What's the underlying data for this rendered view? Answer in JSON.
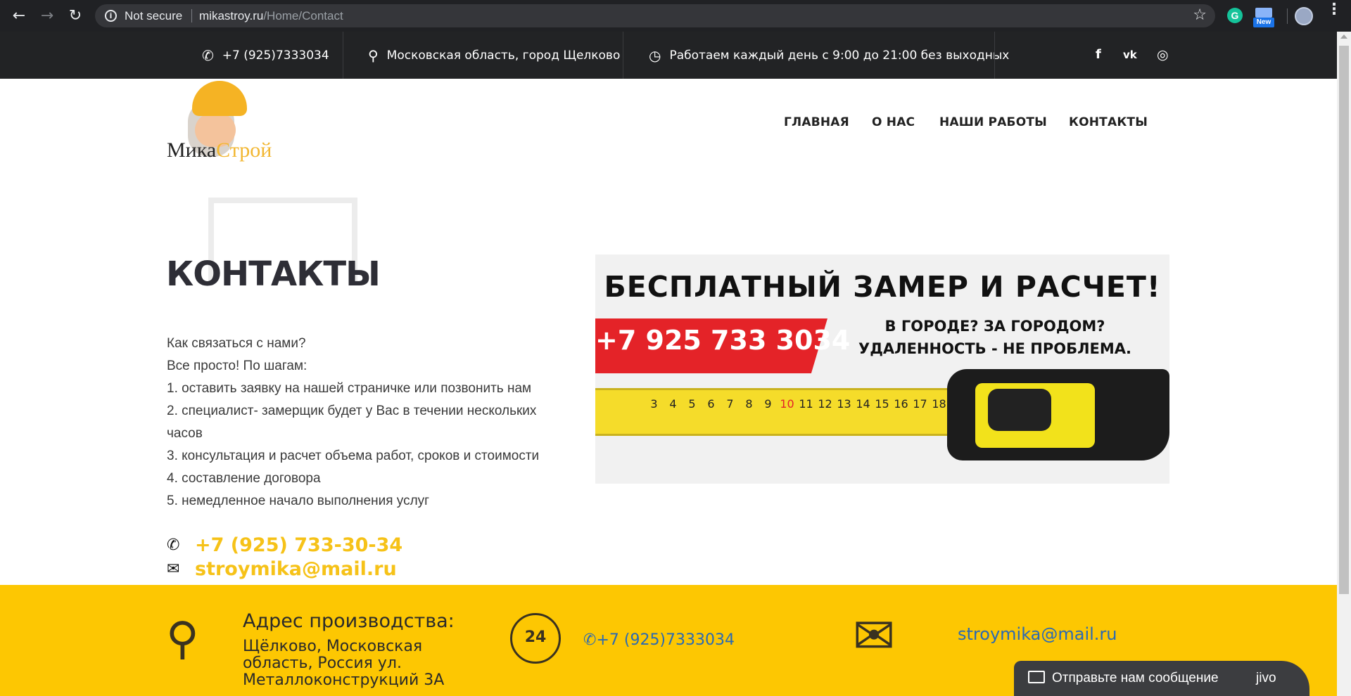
{
  "browser": {
    "security": "Not secure",
    "url_domain": "mikastroy.ru",
    "url_path": "/Home/Contact",
    "ext_new_badge": "New",
    "ext_grammarly_letter": "G"
  },
  "topbar": {
    "phone": "+7 (925)7333034",
    "address": "Московская область, город Щелково",
    "hours": "Работаем каждый день с 9:00 до 21:00 без выходных",
    "social": {
      "facebook": "f",
      "vk": "vk",
      "instagram": "◎"
    }
  },
  "logo": {
    "part1": "Мика",
    "part2": "Строй"
  },
  "nav": {
    "items": [
      {
        "label": "ГЛАВНАЯ"
      },
      {
        "label": "О НАС"
      },
      {
        "label": "НАШИ РАБОТЫ"
      },
      {
        "label": "КОНТАКТЫ"
      }
    ]
  },
  "main": {
    "title": "КОНТАКТЫ",
    "lines": [
      "Как связаться с нами?",
      "Все просто! По шагам:",
      "1. оставить заявку на нашей страничке или позвонить нам",
      "2. специалист- замерщик будет у Вас в течении нескольких часов",
      "3. консультация и расчет объема работ, сроков и стоимости",
      "4. составление договора",
      "5. немедленное начало выполнения услуг"
    ],
    "phone": "+7 (925) 733-30-34",
    "email": "stroymika@mail.ru"
  },
  "banner": {
    "headline": "БЕСПЛАТНЫЙ ЗАМЕР И РАСЧЕТ!",
    "phone": "+7 925 733 3034",
    "sub1": "В ГОРОДЕ? ЗА ГОРОДОМ?",
    "sub2": "УДАЛЕННОСТЬ - НЕ ПРОБЛЕМА.",
    "ticks": [
      "3",
      "4",
      "5",
      "6",
      "7",
      "8",
      "9",
      "10",
      "11",
      "12",
      "13",
      "14",
      "15",
      "16",
      "17",
      "18"
    ]
  },
  "footer": {
    "address_title": "Адрес производства:",
    "address": "Щёлково, Московская область, Россия ул. Металлоконструкций 3А",
    "phone_icon_text": "24",
    "phone": "+7 (925)7333034",
    "email": "stroymika@mail.ru"
  },
  "jivo": {
    "label": "Отправьте нам сообщение",
    "brand": "jivo"
  },
  "colors": {
    "accent_yellow": "#fdc702",
    "topbar_bg": "#222325",
    "link_blue": "#2a6ab4",
    "banner_red": "#e42328"
  }
}
